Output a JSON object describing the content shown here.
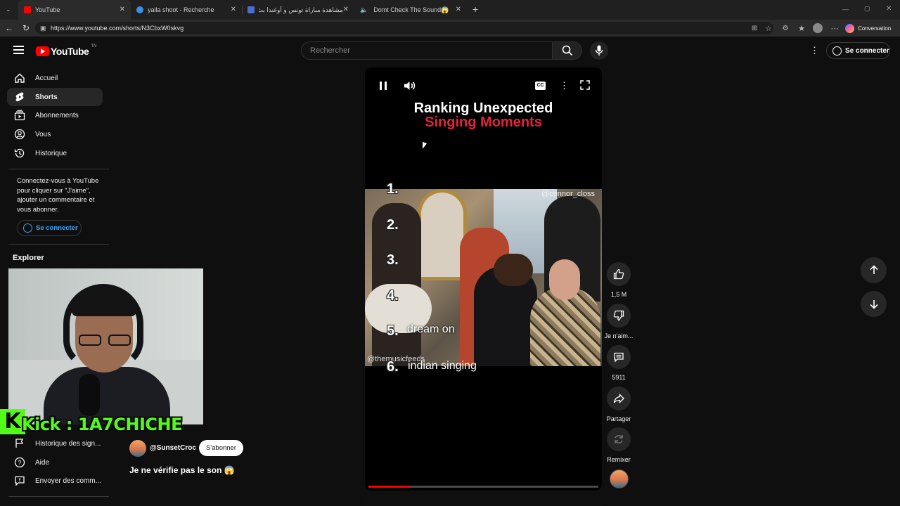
{
  "browser": {
    "tabs": [
      {
        "label": "YouTube",
        "color": "#ff0000"
      },
      {
        "label": "yalla shoot - Recherche",
        "color": "#3a8fe8"
      },
      {
        "label": "مشاهدة مباراة تونس و أوغندا بث مباشر",
        "color": "#4a6cd4"
      },
      {
        "label": "Domt Check The Sound😱",
        "color": "#ff0000"
      }
    ],
    "url": "https://www.youtube.com/shorts/N3CbxW0skvg",
    "copilot_label": "Conversation"
  },
  "header": {
    "logo_text": "YouTube",
    "country": "TN",
    "search_placeholder": "Rechercher",
    "signin_label": "Se connecter"
  },
  "sidebar": {
    "items": [
      {
        "label": "Accueil"
      },
      {
        "label": "Shorts"
      },
      {
        "label": "Abonnements"
      },
      {
        "label": "Vous"
      },
      {
        "label": "Historique"
      }
    ],
    "signin_prompt": "Connectez-vous à YouTube pour cliquer sur \"J'aime\", ajouter un commentaire et vous abonner.",
    "signin_button": "Se connecter",
    "explore_title": "Explorer",
    "bottom_items": [
      {
        "label": "Historique des sign..."
      },
      {
        "label": "Aide"
      },
      {
        "label": "Envoyer des comm..."
      }
    ]
  },
  "overlay": {
    "kick_text": "Kick : 1A7CHICHE"
  },
  "video": {
    "title_line1": "Ranking Unexpected",
    "title_line2": "Singing Moments",
    "watermark": "@connor_closs",
    "watermark2": "@themusicfeeds",
    "rank_labels": [
      "1.",
      "2.",
      "3.",
      "4.",
      "5.",
      "6."
    ],
    "rank5_text": "dream on",
    "rank6_text": "indian singing",
    "progress": 0.18
  },
  "channel": {
    "handle": "@SunsetCroc",
    "subscribe": "S'abonner",
    "caption": "Je ne vérifie pas le son 😱"
  },
  "actions": {
    "likes": "1,5 M",
    "dislike": "Je n'aim...",
    "comments": "5911",
    "share": "Partager",
    "remix": "Remixer"
  }
}
